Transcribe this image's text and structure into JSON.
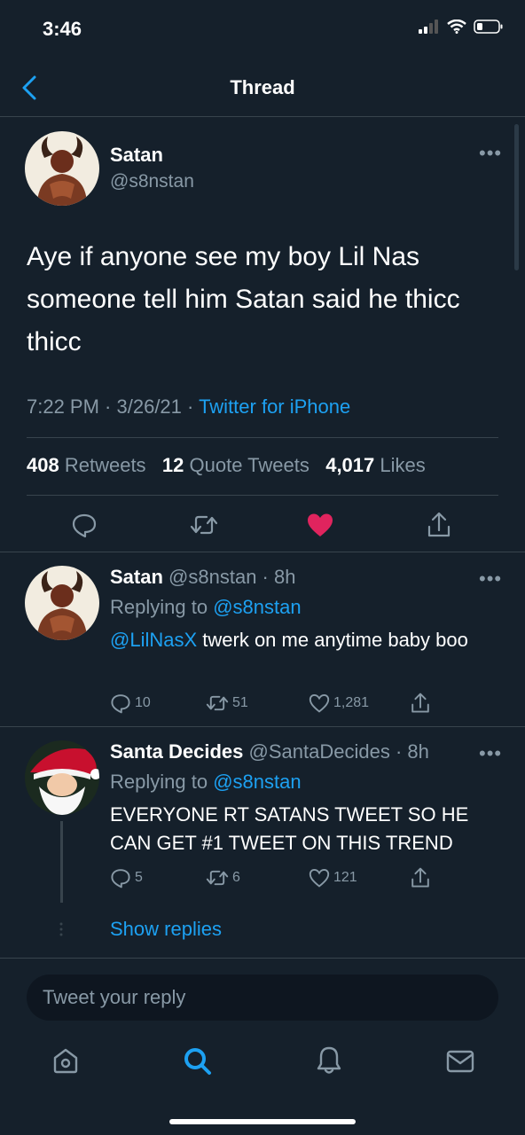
{
  "status": {
    "time": "3:46"
  },
  "header": {
    "title": "Thread"
  },
  "main_tweet": {
    "name": "Satan",
    "handle": "@s8nstan",
    "text": "Aye if anyone see my boy Lil Nas someone tell him Satan said he thicc thicc",
    "time": "7:22 PM",
    "date": "3/26/21",
    "source": "Twitter for iPhone",
    "retweets": "408",
    "retweets_label": "Retweets",
    "quotes": "12",
    "quotes_label": "Quote Tweets",
    "likes": "4,017",
    "likes_label": "Likes",
    "liked": true
  },
  "replies": [
    {
      "name": "Satan",
      "handle": "@s8nstan",
      "age": "8h",
      "replying_label": "Replying to",
      "replying_to": "@s8nstan",
      "mention": "@LilNasX",
      "text": "twerk on me anytime baby boo",
      "replies": "10",
      "retweets": "51",
      "likes": "1,281"
    },
    {
      "name": "Santa Decides",
      "handle": "@SantaDecides",
      "age": "8h",
      "replying_label": "Replying to",
      "replying_to": "@s8nstan",
      "text": "EVERYONE RT SATANS TWEET SO HE CAN GET #1 TWEET ON THIS TREND",
      "replies": "5",
      "retweets": "6",
      "likes": "121",
      "show_replies": "Show replies"
    }
  ],
  "reply_input": {
    "placeholder": "Tweet your reply"
  },
  "tab_bar": [
    "home-icon",
    "search-icon",
    "notifications-icon",
    "messages-icon"
  ],
  "colors": {
    "background": "#15202b",
    "accent": "#1da1f2",
    "like": "#e0245e",
    "muted": "#8899a6"
  }
}
